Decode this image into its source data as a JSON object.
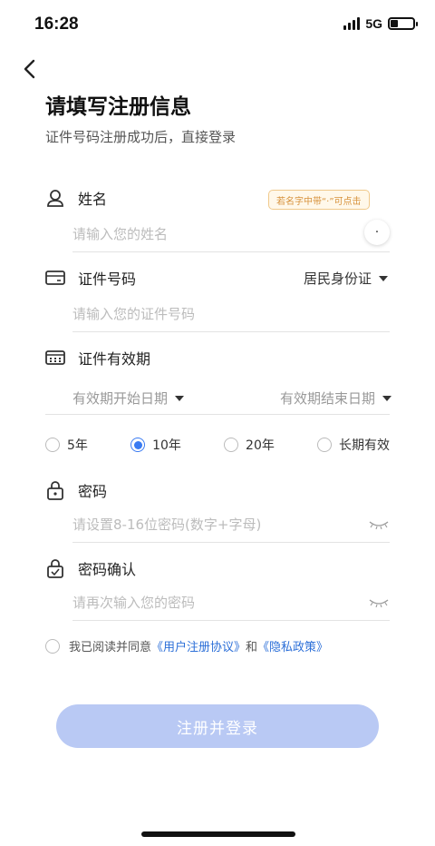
{
  "status_bar": {
    "time": "16:28",
    "network": "5G"
  },
  "page": {
    "title": "请填写注册信息",
    "subtitle": "证件号码注册成功后，直接登录"
  },
  "name_field": {
    "label": "姓名",
    "placeholder": "请输入您的姓名",
    "tip": "若名字中带“·”可点击",
    "dot_button": "·"
  },
  "id_field": {
    "label": "证件号码",
    "type_selected": "居民身份证",
    "placeholder": "请输入您的证件号码"
  },
  "validity_field": {
    "label": "证件有效期",
    "start_placeholder": "有效期开始日期",
    "end_placeholder": "有效期结束日期",
    "options": [
      {
        "label": "5年",
        "checked": false
      },
      {
        "label": "10年",
        "checked": true
      },
      {
        "label": "20年",
        "checked": false
      },
      {
        "label": "长期有效",
        "checked": false
      }
    ]
  },
  "password_field": {
    "label": "密码",
    "placeholder": "请设置8-16位密码(数字+字母)"
  },
  "confirm_field": {
    "label": "密码确认",
    "placeholder": "请再次输入您的密码"
  },
  "agreement": {
    "prefix": "我已阅读并同意",
    "user_agreement": "《用户注册协议》",
    "and": "和",
    "privacy_policy": "《隐私政策》"
  },
  "submit_label": "注册并登录",
  "colors": {
    "accent": "#3a7bf2",
    "link": "#2c6fd8",
    "button_disabled": "#b9c9f4",
    "tip_text": "#d7923c"
  }
}
